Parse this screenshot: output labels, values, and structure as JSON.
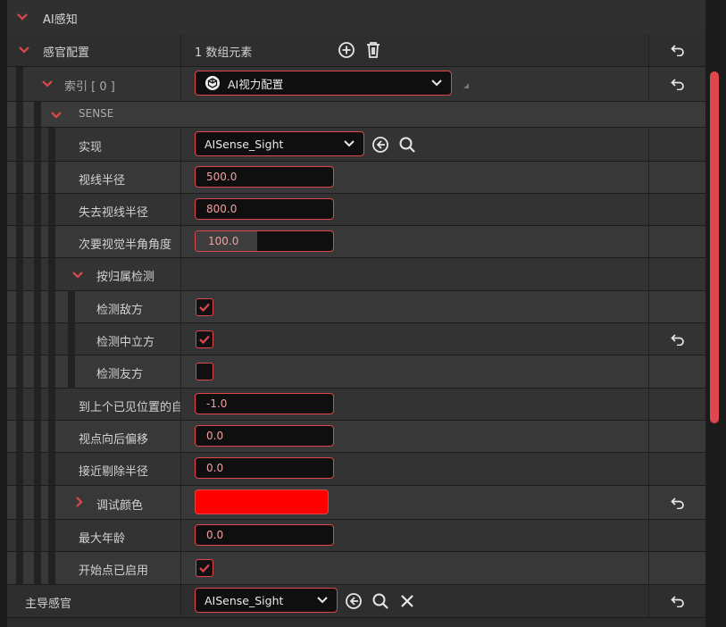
{
  "section": {
    "title": "AI感知"
  },
  "senses_config": {
    "label": "感官配置",
    "count_text": "1 数组元素"
  },
  "index_row": {
    "label": "索引 [ 0 ]",
    "value": "AI视力配置"
  },
  "sense_group": {
    "label": "SENSE"
  },
  "implementation": {
    "label": "实现",
    "value": "AISense_Sight"
  },
  "sight_radius": {
    "label": "视线半径",
    "value": "500.0"
  },
  "lose_sight_radius": {
    "label": "失去视线半径",
    "value": "800.0"
  },
  "peripheral_angle": {
    "label": "次要视觉半角角度",
    "value": "100.0",
    "fill_percent": 45
  },
  "affiliation": {
    "label": "按归属检测",
    "enemies": {
      "label": "检测敌方",
      "checked": true
    },
    "neutrals": {
      "label": "检测中立方",
      "checked": true
    },
    "friendlies": {
      "label": "检测友方",
      "checked": false
    }
  },
  "last_seen_location": {
    "label": "到上个已见位置的自",
    "value": "-1.0"
  },
  "point_of_view_offset": {
    "label": "视点向后偏移",
    "value": "0.0"
  },
  "near_clipping_radius": {
    "label": "接近剔除半径",
    "value": "0.0"
  },
  "debug_color": {
    "label": "调试颜色",
    "color": "#ff0000"
  },
  "max_age": {
    "label": "最大年龄",
    "value": "0.0"
  },
  "starts_enabled": {
    "label": "开始点已启用",
    "checked": true
  },
  "dominant_sense": {
    "label": "主导感官",
    "value": "AISense_Sight"
  },
  "colors": {
    "accent": "#e0474c",
    "debug_red": "#ff0000"
  }
}
